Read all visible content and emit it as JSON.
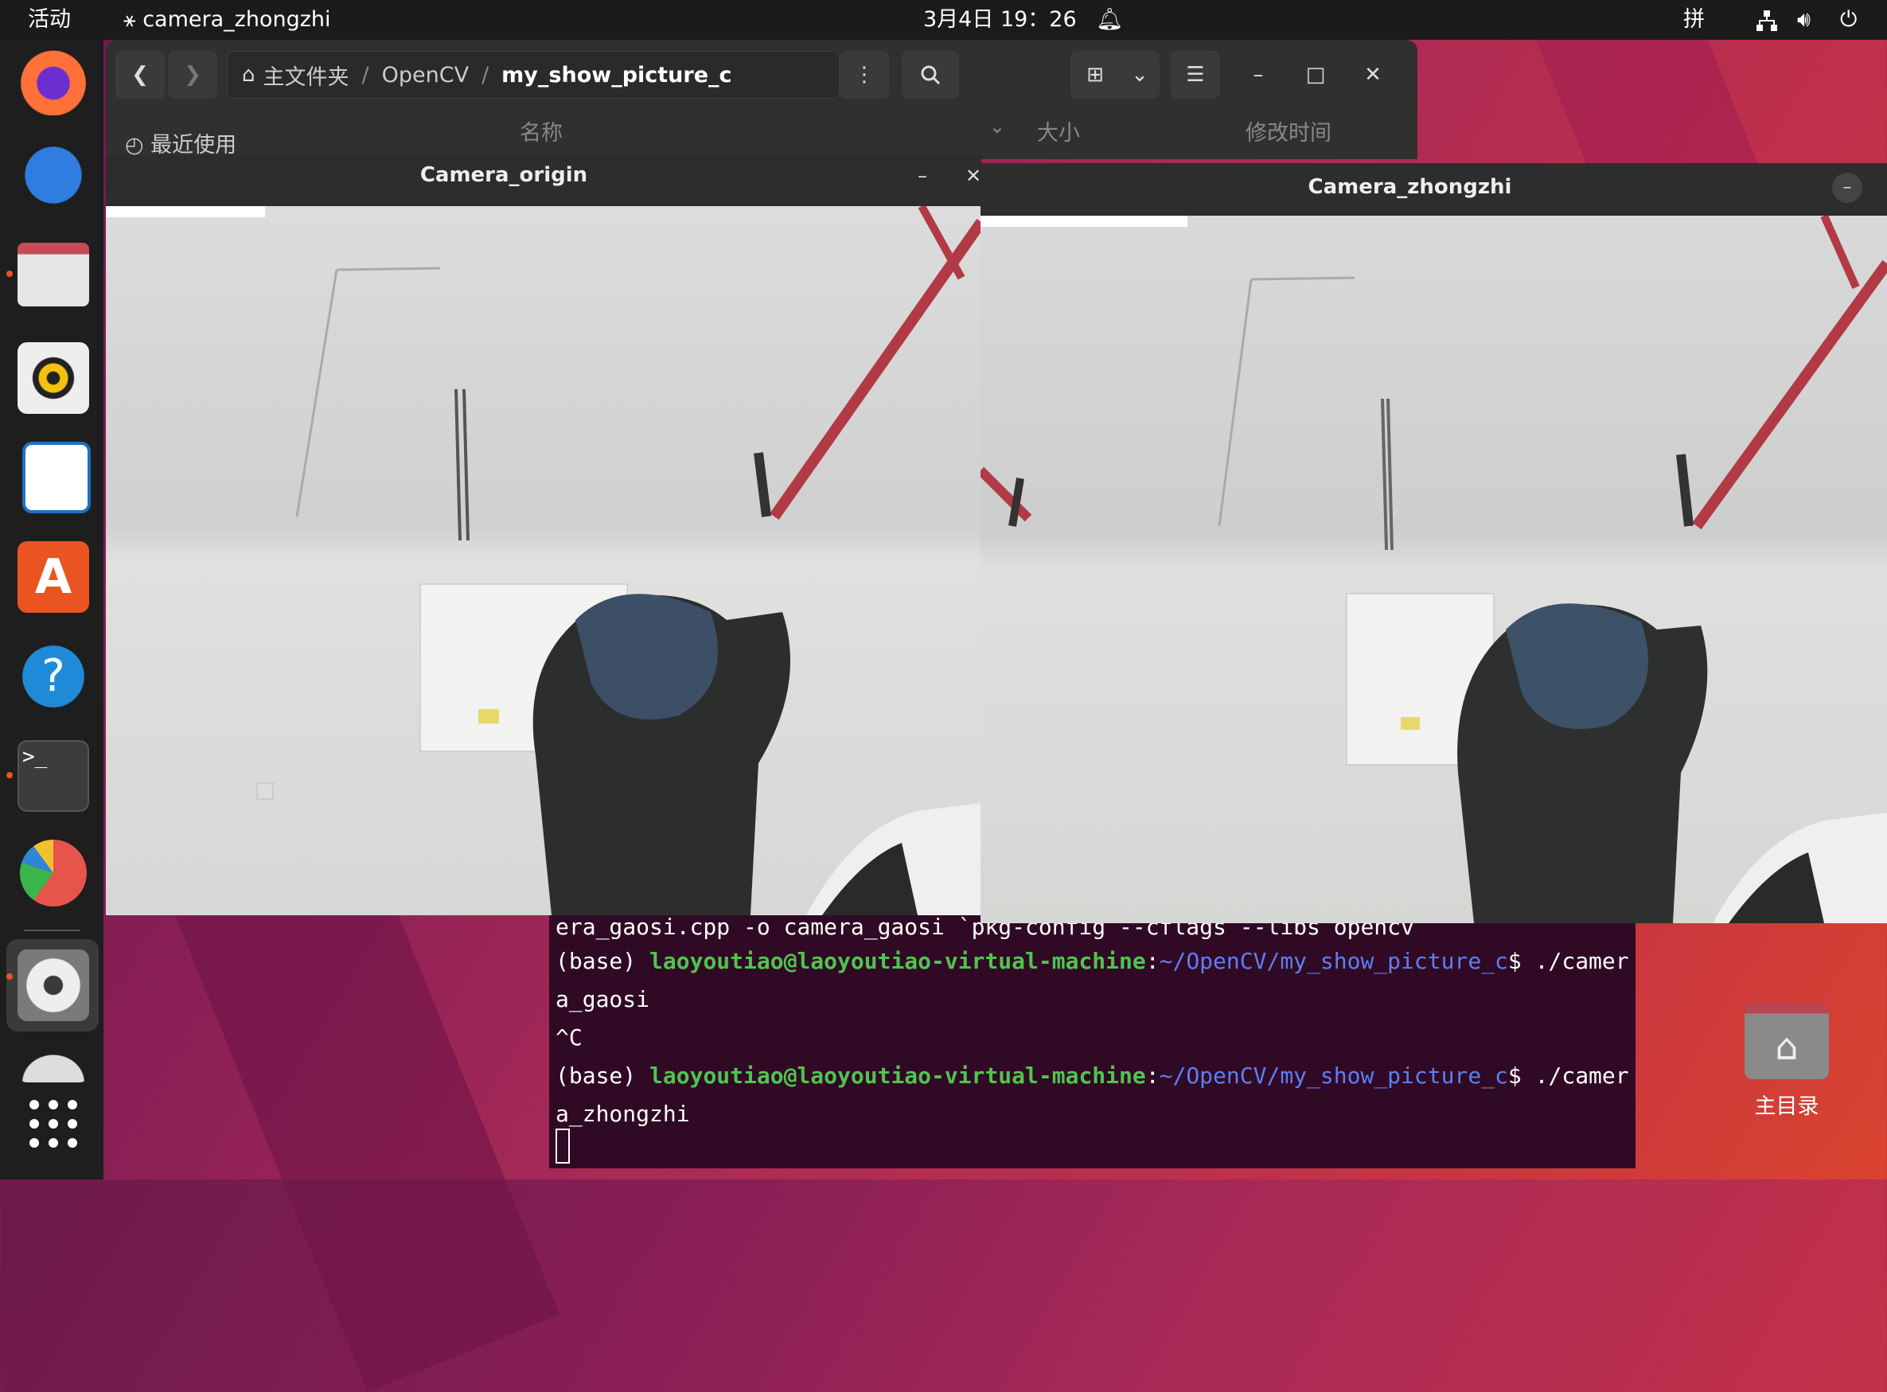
{
  "topbar": {
    "activities": "活动",
    "app_name": "camera_zhongzhi",
    "clock": "3月4日 19：26",
    "input_method": "拼"
  },
  "files": {
    "breadcrumb": [
      "主文件夹",
      "OpenCV",
      "my_show_picture_c"
    ],
    "sidebar_item": "最近使用",
    "columns": [
      "名称",
      "大小",
      "修改时间"
    ]
  },
  "camera_origin": {
    "title": "Camera_origin"
  },
  "camera_zhongzhi": {
    "title": "Camera_zhongzhi"
  },
  "terminal": {
    "line0": "era_gaosi.cpp -o camera_gaosi `pkg-config --cflags --libs opencv`",
    "prompt_base": "(base) ",
    "user_host": "laoyoutiao@laoyoutiao-virtual-machine",
    "colon": ":",
    "path": "~/OpenCV/my_show_picture_c",
    "cmd1": "$ ./camer",
    "cont1": "a_gaosi",
    "interrupt": "^C",
    "cmd2": "$ ./camer",
    "cont2": "a_zhongzhi"
  },
  "desktop": {
    "home_label": "主目录"
  },
  "colors": {
    "accent": "#e95420",
    "terminal_bg": "#300a24",
    "prompt_green": "#4fc44f",
    "path_blue": "#5e7ef5"
  }
}
